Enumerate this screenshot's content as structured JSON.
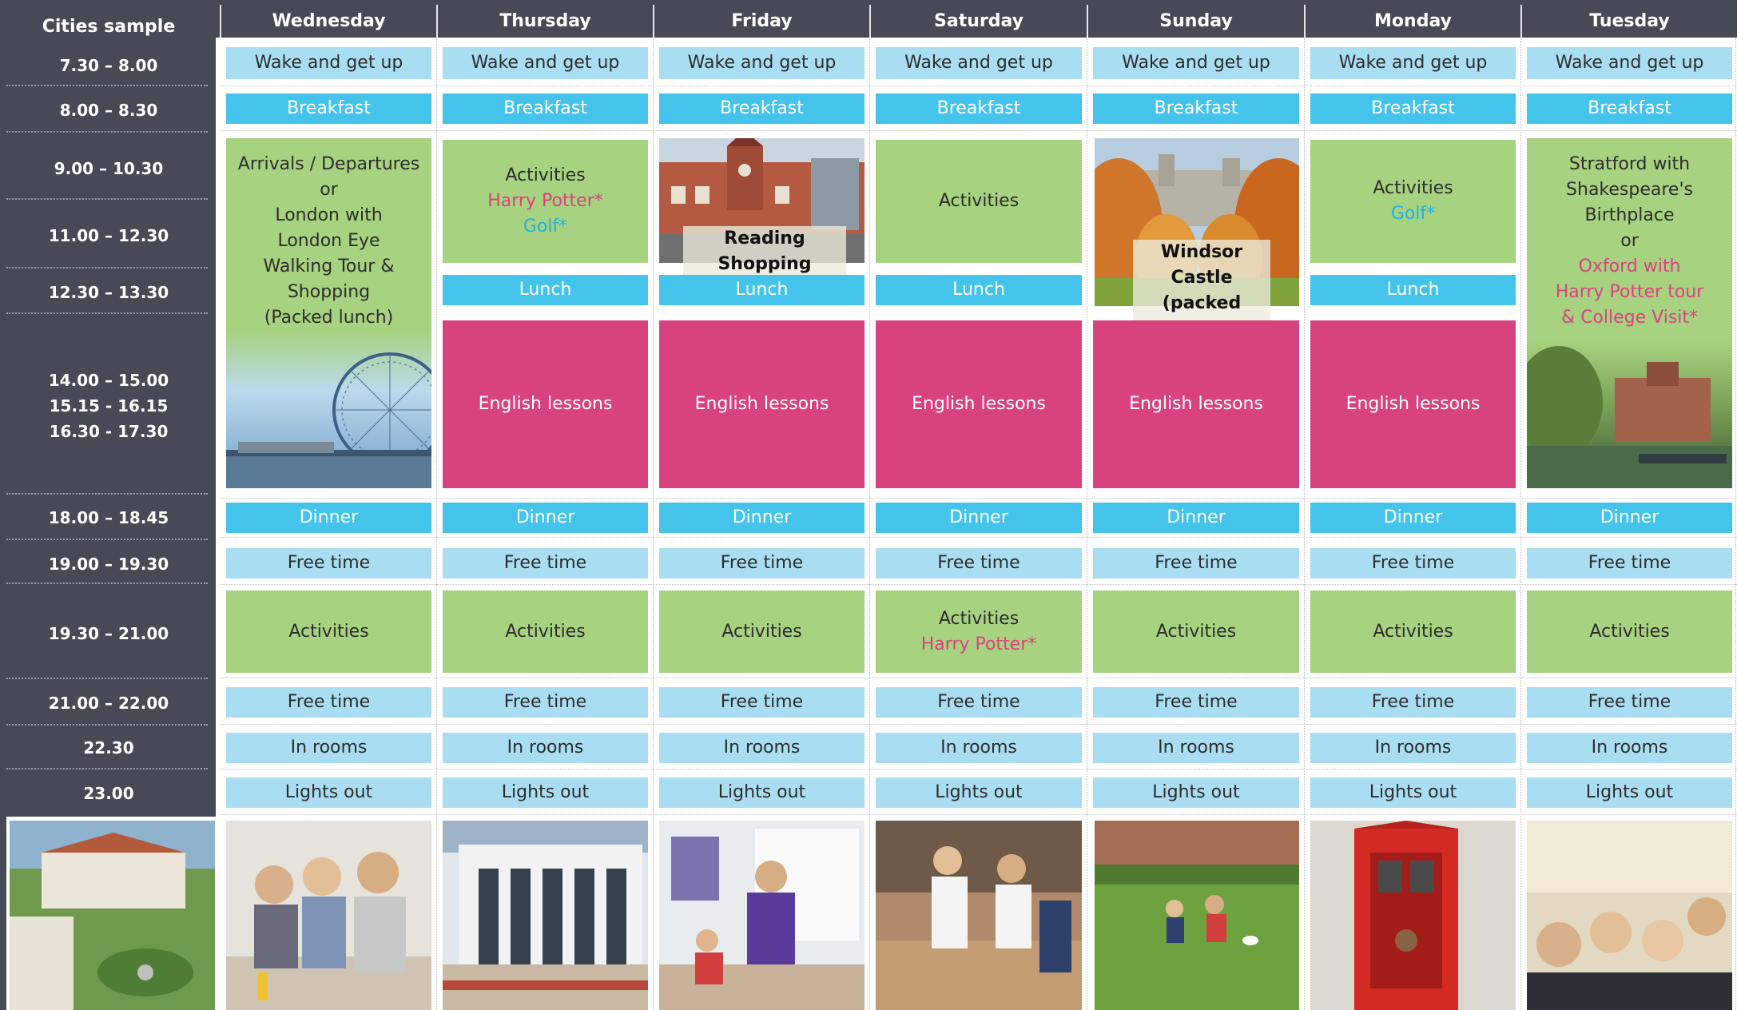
{
  "corner_title": "Cities sample",
  "days": [
    "Wednesday",
    "Thursday",
    "Friday",
    "Saturday",
    "Sunday",
    "Monday",
    "Tuesday"
  ],
  "times": {
    "t1": "7.30 – 8.00",
    "t2": "8.00 – 8.30",
    "t3": "9.00 – 10.30",
    "t4": "11.00 – 12.30",
    "t5": "12.30 – 13.30",
    "t6a": "14.00 – 15.00",
    "t6b": "15.15 - 16.15",
    "t6c": "16.30 - 17.30",
    "t7": "18.00 – 18.45",
    "t8": "19.00 – 19.30",
    "t9": "19.30 – 21.00",
    "t10": "21.00 – 22.00",
    "t11": "22.30",
    "t12": "23.00"
  },
  "common": {
    "wake": "Wake and get up",
    "breakfast": "Breakfast",
    "lunch": "Lunch",
    "english": "English lessons",
    "dinner": "Dinner",
    "free": "Free time",
    "activities": "Activities",
    "in_rooms": "In rooms",
    "lights_out": "Lights out"
  },
  "wed_block": {
    "l1": "Arrivals / Departures",
    "l2": "or",
    "l3": "London with",
    "l4": "London Eye",
    "l5": "Walking Tour &",
    "l6": "Shopping",
    "l7": "(Packed lunch)"
  },
  "thu_morning": {
    "l1": "Activities",
    "l2": "Harry Potter*",
    "l3": "Golf*"
  },
  "fri_morning": {
    "caption": "Reading Shopping"
  },
  "sat_morning": {
    "l1": "Activities"
  },
  "sun_block": {
    "l1": "Windsor Castle",
    "l2": "(packed lunch)"
  },
  "mon_morning": {
    "l1": "Activities",
    "l2": "Golf*"
  },
  "tue_block": {
    "l1": "Stratford with",
    "l2": "Shakespeare's",
    "l3": "Birthplace",
    "l4": "or",
    "l5": "Oxford with",
    "l6": "Harry Potter tour",
    "l7": "& College Visit*"
  },
  "sat_evening": {
    "l1": "Activities",
    "l2": "Harry Potter*"
  },
  "colors": {
    "sidebar": "#454a55",
    "light_blue": "#a9ddf1",
    "blue": "#44c4ea",
    "green": "#a7d27f",
    "pink": "#d8437f"
  }
}
